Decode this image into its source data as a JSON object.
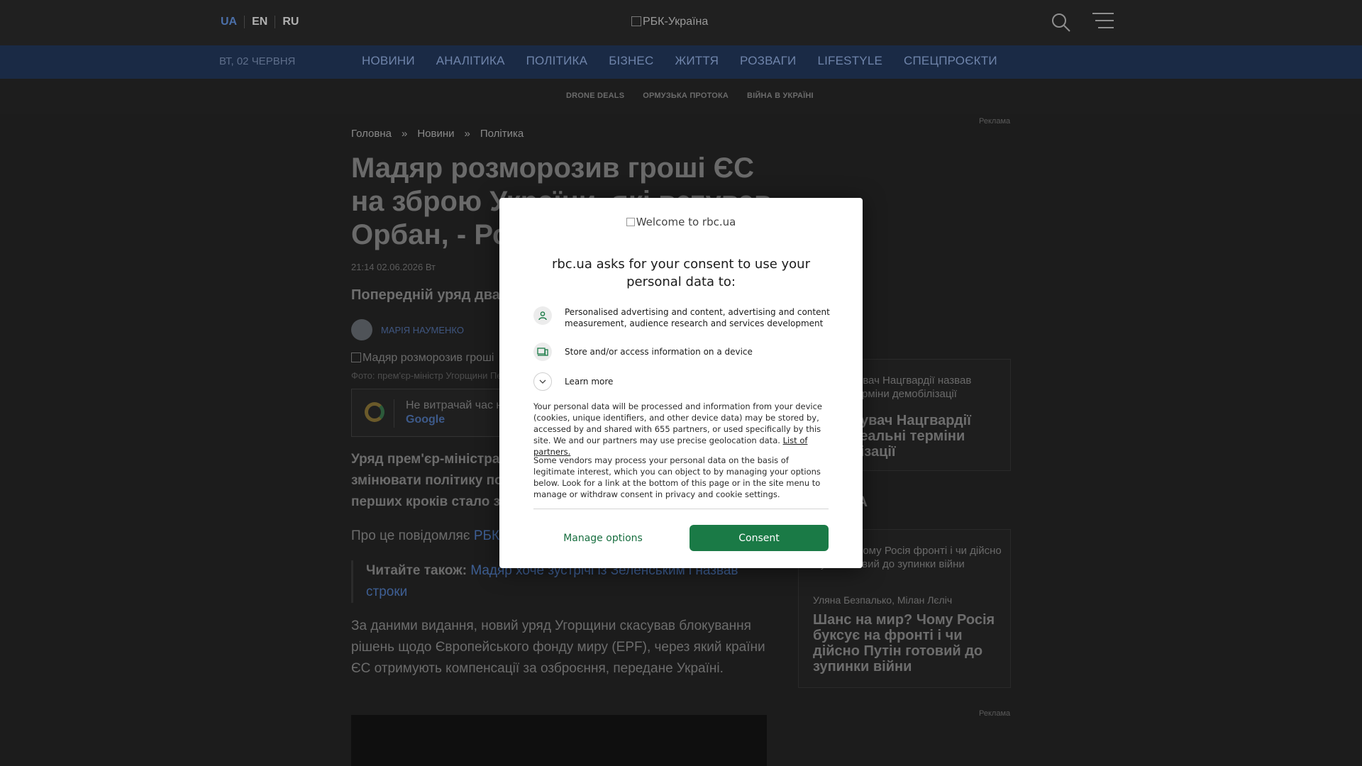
{
  "header": {
    "langs": [
      "UA",
      "EN",
      "RU"
    ],
    "logo_alt": "РБК-Україна"
  },
  "nav": {
    "date": "ВТ, 02 ЧЕРВНЯ",
    "items": [
      "НОВИНИ",
      "АНАЛІТИКА",
      "ПОЛІТИКА",
      "БІЗНЕС",
      "ЖИТТЯ",
      "РОЗВАГИ",
      "LIFESTYLE",
      "СПЕЦПРОЄКТИ"
    ],
    "subitems": [
      "DRONE DEALS",
      "ОРМУЗЬКА ПРОТОКА",
      "ВІЙНА В УКРАЇНІ"
    ]
  },
  "ads": {
    "label": "Реклама"
  },
  "article": {
    "breadcrumbs": [
      "Головна",
      "»",
      "Новини",
      "»",
      "Політика"
    ],
    "title": "Мадяр розморозив гроші ЄС на зброю України, які ветував Орбан, - Ро",
    "timestamp": "21:14 02.06.2026 Вт",
    "lead": "Попередній уряд два р",
    "author": "МАРІЯ НАУМЕНКО",
    "photo_alt": "Мадяр розморозив гроші",
    "caption": "Фото: прем'єр-міністр Угорщини Пе",
    "google_box": {
      "text": "Не витрачай час н",
      "link": "Google"
    },
    "para1_l1": "Уряд прем'єр-міністра",
    "para1_l2": "змінювати політику пог",
    "para1_l3": "перших кроків стало зн",
    "para2_prefix": "Про це повідомляє",
    "para2_link": "РБК",
    "readalso_label": "Читайте також:",
    "readalso_link": "Мадяр хоче зустрічі із Зеленським і назвав строки",
    "para3": "За даними видання, новий уряд Угорщини скасував блокування рішень щодо Європейського фонду миру (EPF), через який країни ЄС отримують компенсації за озброєння, передане Україні."
  },
  "sidebar": {
    "card1_small": "дувач Нацгвардії назвав терміни демобілізації",
    "card1_big": "дувач Нацгвардії реальні терміни лізації",
    "heading": "КА",
    "card2_small": "на мир? Чому Росія фронті і чи дійсно Путін готовий до зупинки війни",
    "card2_authors": "Уляна Безпалько, Мілан Лєліч",
    "card2_big": "Шанс на мир? Чому Росія буксує на фронті і чи дійсно Путін готовий до зупинки війни"
  },
  "consent_modal": {
    "logo_alt": "Welcome to rbc.ua",
    "title": "rbc.ua asks for your consent to use your personal data to:",
    "purpose1": "Personalised advertising and content, advertising and content measurement, audience research and services development",
    "purpose2": "Store and/or access information on a device",
    "learn_more": "Learn more",
    "body1": "Your personal data will be processed and information from your device (cookies, unique identifiers, and other device data) may be stored by, accessed by and shared with 655 partners, or used specifically by this site. We and our partners may use precise geolocation data.",
    "partners_link": "List of partners.",
    "body2": "Some vendors may process your personal data on the basis of legitimate interest, which you can object to by managing your options below. Look for a link at the bottom of this page or in the site menu to manage or withdraw consent in privacy and cookie settings.",
    "manage_label": "Manage options",
    "consent_label": "Consent",
    "accent_color": "#1a7a46"
  }
}
